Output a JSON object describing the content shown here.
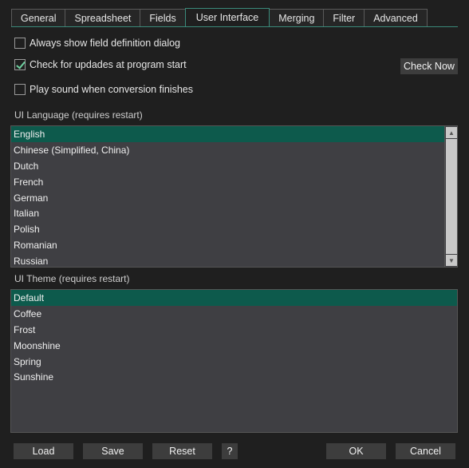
{
  "tabs": [
    {
      "label": "General"
    },
    {
      "label": "Spreadsheet"
    },
    {
      "label": "Fields"
    },
    {
      "label": "User Interface",
      "active": true
    },
    {
      "label": "Merging"
    },
    {
      "label": "Filter"
    },
    {
      "label": "Advanced"
    }
  ],
  "options": {
    "field_def": {
      "label": "Always show field definition dialog",
      "checked": false
    },
    "updates": {
      "label": "Check for updades at program start",
      "checked": true
    },
    "sound": {
      "label": "Play sound when conversion finishes",
      "checked": false
    },
    "check_now_label": "Check Now"
  },
  "language": {
    "label": "UI Language (requires restart)",
    "items": [
      "English",
      "Chinese (Simplified, China)",
      "Dutch",
      "French",
      "German",
      "Italian",
      "Polish",
      "Romanian",
      "Russian"
    ],
    "selected": "English"
  },
  "theme": {
    "label": "UI Theme (requires restart)",
    "items": [
      "Default",
      "Coffee",
      "Frost",
      "Moonshine",
      "Spring",
      "Sunshine"
    ],
    "selected": "Default"
  },
  "footer": {
    "load": "Load",
    "save": "Save",
    "reset": "Reset",
    "help": "?",
    "ok": "OK",
    "cancel": "Cancel"
  },
  "colors": {
    "accent": "#0d5a4c",
    "background": "#1f1f1f",
    "list_background": "#3f3f43"
  }
}
